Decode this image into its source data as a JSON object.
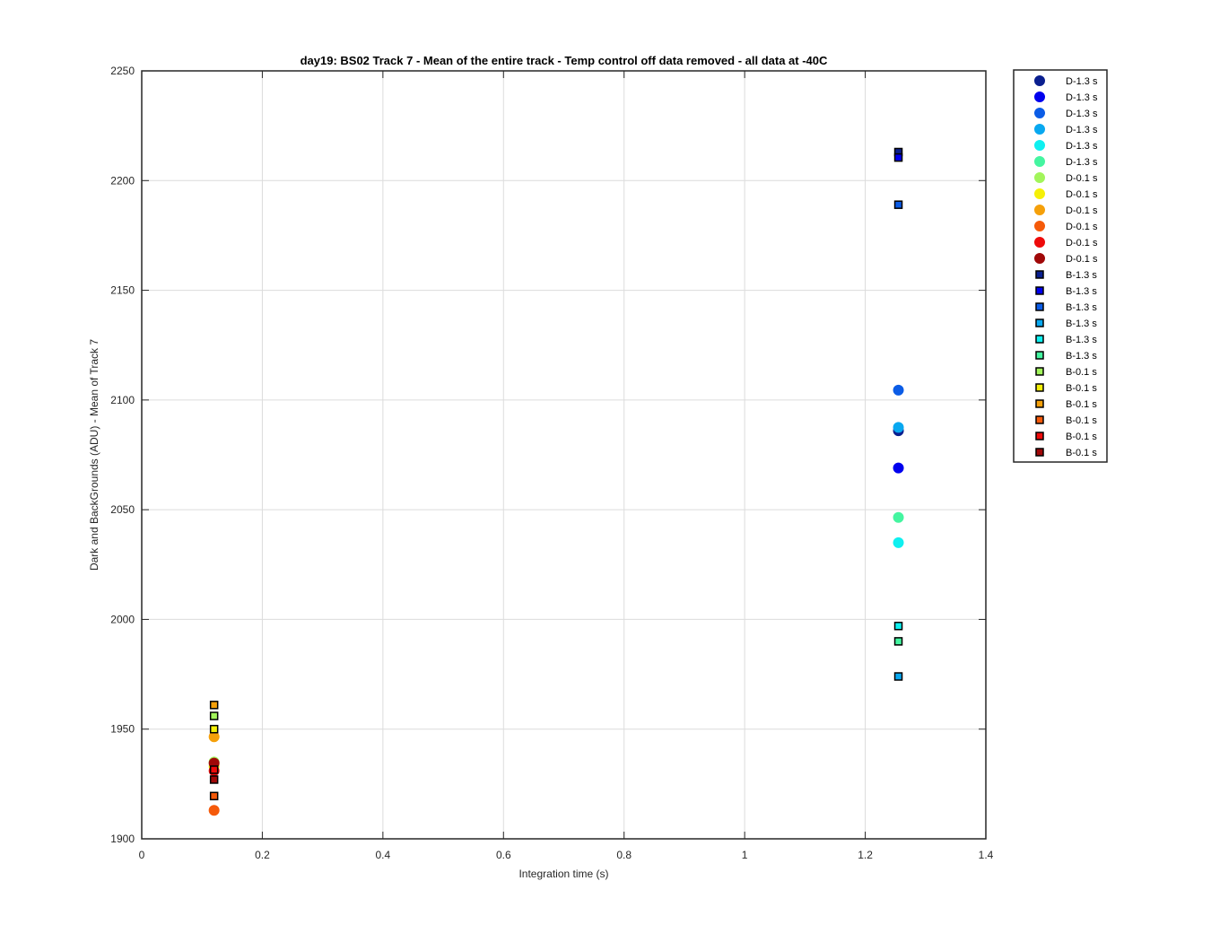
{
  "chart_data": {
    "type": "scatter",
    "title": "day19: BS02  Track 7 - Mean of the entire track - Temp control off data removed - all data at -40C",
    "xlabel": "Integration time (s)",
    "ylabel": "Dark and BackGrounds (ADU) - Mean of Track 7",
    "xlim": [
      0,
      1.4
    ],
    "ylim": [
      1900,
      2250
    ],
    "xticks": [
      "0",
      "0.2",
      "0.4",
      "0.6",
      "0.8",
      "1",
      "1.2",
      "1.4"
    ],
    "yticks": [
      "1900",
      "1950",
      "2000",
      "2050",
      "2100",
      "2150",
      "2200",
      "2250"
    ],
    "grid": true,
    "legend_position": "outside-top-right",
    "series": [
      {
        "name": "D-1.3 s",
        "marker": "circle",
        "color": "#0a1f8f",
        "points": [
          [
            1.255,
            2086
          ]
        ]
      },
      {
        "name": "D-1.3 s",
        "marker": "circle",
        "color": "#0000ee",
        "points": [
          [
            1.255,
            2069
          ]
        ]
      },
      {
        "name": "D-1.3 s",
        "marker": "circle",
        "color": "#0b5ce6",
        "points": [
          [
            1.255,
            2104.5
          ]
        ]
      },
      {
        "name": "D-1.3 s",
        "marker": "circle",
        "color": "#08a8f0",
        "points": [
          [
            1.255,
            2087.5
          ]
        ]
      },
      {
        "name": "D-1.3 s",
        "marker": "circle",
        "color": "#0ff0f0",
        "points": [
          [
            1.255,
            2035
          ]
        ]
      },
      {
        "name": "D-1.3 s",
        "marker": "circle",
        "color": "#44f5a0",
        "points": [
          [
            1.255,
            2046.5
          ]
        ]
      },
      {
        "name": "D-0.1 s",
        "marker": "circle",
        "color": "#a2f55b",
        "points": [
          [
            0.12,
            1935
          ]
        ]
      },
      {
        "name": "D-0.1 s",
        "marker": "circle",
        "color": "#f5f008",
        "points": [
          [
            0.12,
            1933
          ]
        ]
      },
      {
        "name": "D-0.1 s",
        "marker": "circle",
        "color": "#f5a00a",
        "points": [
          [
            0.12,
            1946.5
          ]
        ]
      },
      {
        "name": "D-0.1 s",
        "marker": "circle",
        "color": "#f55a0a",
        "points": [
          [
            0.12,
            1913
          ]
        ]
      },
      {
        "name": "D-0.1 s",
        "marker": "circle",
        "color": "#ee0b0b",
        "points": [
          [
            0.12,
            1931
          ]
        ]
      },
      {
        "name": "D-0.1 s",
        "marker": "circle",
        "color": "#a00808",
        "points": [
          [
            0.12,
            1934.5
          ]
        ]
      },
      {
        "name": "B-1.3 s",
        "marker": "square",
        "color": "#0a1f8f",
        "points": [
          [
            1.255,
            2213
          ]
        ]
      },
      {
        "name": "B-1.3 s",
        "marker": "square",
        "color": "#0000ee",
        "points": [
          [
            1.255,
            2210.5
          ]
        ]
      },
      {
        "name": "B-1.3 s",
        "marker": "square",
        "color": "#0b5ce6",
        "points": [
          [
            1.255,
            2189
          ]
        ]
      },
      {
        "name": "B-1.3 s",
        "marker": "square",
        "color": "#08a8f0",
        "points": [
          [
            1.255,
            1974
          ]
        ]
      },
      {
        "name": "B-1.3 s",
        "marker": "square",
        "color": "#0ff0f0",
        "points": [
          [
            1.255,
            1997
          ]
        ]
      },
      {
        "name": "B-1.3 s",
        "marker": "square",
        "color": "#44f5a0",
        "points": [
          [
            1.255,
            1990
          ]
        ]
      },
      {
        "name": "B-0.1 s",
        "marker": "square",
        "color": "#a2f55b",
        "points": [
          [
            0.12,
            1956
          ]
        ]
      },
      {
        "name": "B-0.1 s",
        "marker": "square",
        "color": "#f5f008",
        "points": [
          [
            0.12,
            1950
          ]
        ]
      },
      {
        "name": "B-0.1 s",
        "marker": "square",
        "color": "#f5a00a",
        "points": [
          [
            0.12,
            1961
          ]
        ]
      },
      {
        "name": "B-0.1 s",
        "marker": "square",
        "color": "#f55a0a",
        "points": [
          [
            0.12,
            1919.5
          ]
        ]
      },
      {
        "name": "B-0.1 s",
        "marker": "square",
        "color": "#ee0b0b",
        "points": [
          [
            0.12,
            1931.5
          ]
        ]
      },
      {
        "name": "B-0.1 s",
        "marker": "square",
        "color": "#a00808",
        "points": [
          [
            0.12,
            1927
          ]
        ]
      }
    ]
  }
}
